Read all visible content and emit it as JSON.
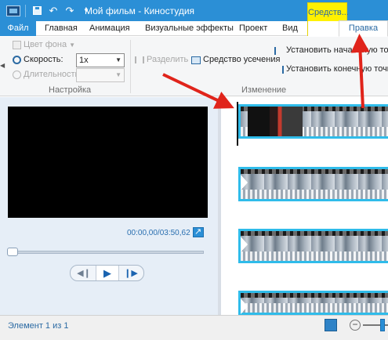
{
  "window": {
    "title": "Мой фильм - Киностудия",
    "contextual_tab": "Средств..."
  },
  "tabs": {
    "file": "Файл",
    "home": "Главная",
    "animation": "Анимация",
    "visual_effects": "Визуальные эффекты",
    "project": "Проект",
    "view": "Вид",
    "edit": "Правка"
  },
  "ribbon": {
    "settings": {
      "background_color": "Цвет фона",
      "speed_label": "Скорость:",
      "speed_value": "1x",
      "duration_label": "Длительность:",
      "duration_value": "",
      "caption": "Настройка"
    },
    "editing": {
      "split": "Разделить",
      "trim_tool": "Средство усечения",
      "set_start": "Установить начальную точку",
      "set_end": "Установить конечную точку",
      "caption": "Изменение"
    }
  },
  "preview": {
    "time": "00:00,00/03:50,62",
    "seek_fraction": 0
  },
  "status": {
    "text": "Элемент 1 из 1"
  },
  "colors": {
    "accent": "#2b8fd6",
    "contextual": "#fff100",
    "clip_border": "#2fbcea",
    "annotation": "#e0241b"
  }
}
